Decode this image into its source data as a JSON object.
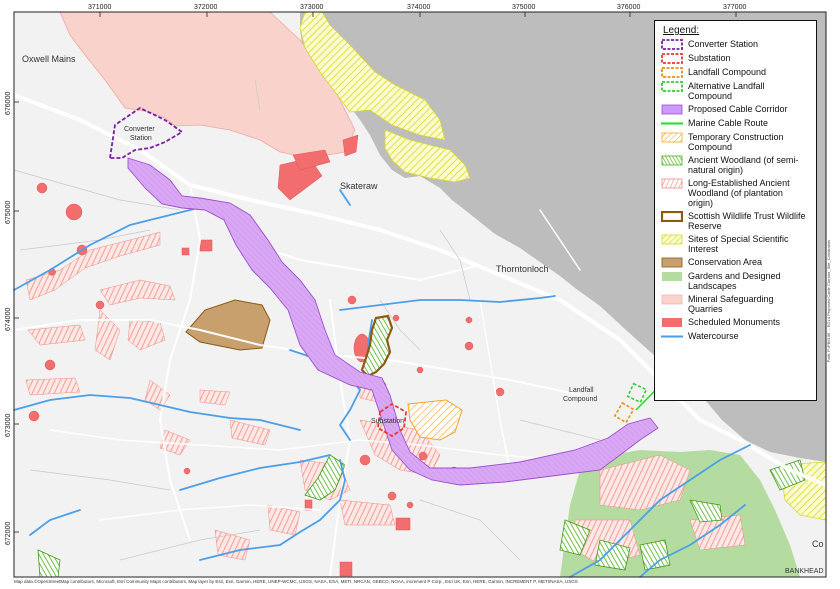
{
  "grid": {
    "x_labels": [
      "371000",
      "372000",
      "373000",
      "374000",
      "375000",
      "376000",
      "377000"
    ],
    "y_labels": [
      "676000",
      "675000",
      "674000",
      "673000",
      "672000"
    ]
  },
  "places": {
    "oxwell_mains": "Oxwell Mains",
    "skateraw": "Skateraw",
    "thorntonloch": "Thorntonloch",
    "bankhead": "BANKHEAD",
    "bankhead_partial": "Co"
  },
  "feature_labels": {
    "converter_station": [
      "Converter",
      "Station"
    ],
    "substation": "Substation",
    "landfall_compound": [
      "Landfall",
      "Compound"
    ]
  },
  "legend": {
    "title": "Legend:",
    "items": [
      {
        "id": "converter-station",
        "label": "Converter Station",
        "color": "#7b1fa2"
      },
      {
        "id": "substation",
        "label": "Substation",
        "color": "#e53935"
      },
      {
        "id": "landfall-compound",
        "label": "Landfall Compound",
        "color": "#ef8c1a"
      },
      {
        "id": "alt-landfall",
        "label": "Alternative Landfall Compound",
        "color": "#33cc33"
      },
      {
        "id": "cable-corridor",
        "label": "Proposed Cable Corridor",
        "color": "#cc99ff"
      },
      {
        "id": "marine-cable",
        "label": "Marine Cable Route",
        "color": "#22dd22"
      },
      {
        "id": "temp-compound",
        "label": "Temporary Construction Compound",
        "color": "#f5a623"
      },
      {
        "id": "ancient-woodland",
        "label": "Ancient Woodland (of semi-natural origin)",
        "color": "#4caf1a"
      },
      {
        "id": "lepo-woodland",
        "label": "Long-Established Ancient Woodland (of plantation origin)",
        "color": "#f28b82"
      },
      {
        "id": "swt-reserve",
        "label": "Scottish Wildlife Trust Wildlife Reserve",
        "color": "#8b5a14"
      },
      {
        "id": "sssi",
        "label": "Sites of Special Scientific Interest",
        "color": "#eeee44"
      },
      {
        "id": "conservation-area",
        "label": "Conservation Area",
        "color": "#c8a06e"
      },
      {
        "id": "gardens",
        "label": "Gardens and Designed Landscapes",
        "color": "#b5dca0"
      },
      {
        "id": "mineral",
        "label": "Mineral Safeguarding Quarries",
        "color": "#f9d2cc"
      },
      {
        "id": "monuments",
        "label": "Scheduled Monuments",
        "color": "#f26d6d"
      },
      {
        "id": "watercourse",
        "label": "Watercourse",
        "color": "#4a9fe8"
      }
    ]
  },
  "credit": "Map data ©OpenStreetMap contributors, Microsoft, Esri Community Maps contributors, Map layer by Esri, Esri, Garmin, HERE, UNEP-WCMC, USGS, NASA, ESA, METI, NRCAN, GEBCO, NOAA, increment P Corp., Esri UK, Esri, HERE, Garmin, INCREMENT P, METI/NASA, USGS",
  "side_text": "Path: P:\\PB6106 ... EGL4 Proposed Cable Corridor_Site_Constraints"
}
